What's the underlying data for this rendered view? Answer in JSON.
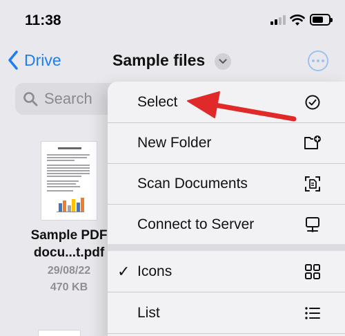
{
  "status_bar": {
    "time": "11:38"
  },
  "nav": {
    "back_label": "Drive",
    "title": "Sample files"
  },
  "search": {
    "placeholder": "Search"
  },
  "file": {
    "name_line1": "Sample PDF",
    "name_line2": "docu...t.pdf",
    "date": "29/08/22",
    "size": "470 KB",
    "thumbnail_heading": "Lorem ipsum"
  },
  "menu": {
    "items": [
      {
        "label": "Select",
        "icon": "checkmark-circle-icon"
      },
      {
        "label": "New Folder",
        "icon": "folder-plus-icon"
      },
      {
        "label": "Scan Documents",
        "icon": "scan-document-icon"
      },
      {
        "label": "Connect to Server",
        "icon": "server-icon"
      },
      {
        "label": "Icons",
        "icon": "grid-icon",
        "checked": true,
        "check_mark": "✓"
      },
      {
        "label": "List",
        "icon": "list-icon"
      }
    ]
  },
  "colors": {
    "accent": "#1f7df3",
    "annotation_arrow": "#e02a2a",
    "menu_background": "#f2f2f4",
    "page_background": "#e9e9ed"
  }
}
